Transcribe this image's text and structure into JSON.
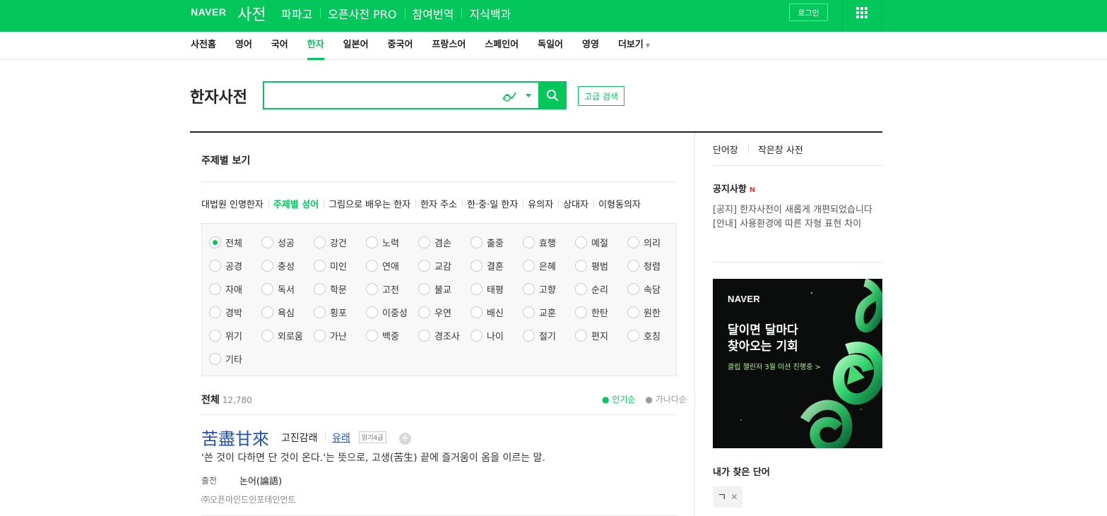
{
  "header": {
    "logo": "NAVER",
    "service": "사전",
    "nav": [
      "파파고",
      "오픈사전 PRO",
      "참여번역",
      "지식백과"
    ],
    "login_label": "로그인",
    "apps_icon": "apps-grid-icon"
  },
  "subnav": {
    "tabs": [
      "사전홈",
      "영어",
      "국어",
      "한자",
      "일본어",
      "중국어",
      "프랑스어",
      "스페인어",
      "독일어",
      "영영",
      "더보기"
    ],
    "active": "한자"
  },
  "search": {
    "title": "한자사전",
    "value": "",
    "advanced_label": "고급 검색"
  },
  "topic": {
    "title": "주제별 보기",
    "tabs": [
      "대법원 인명한자",
      "주제별 성어",
      "그림으로 배우는 한자",
      "한자 주소",
      "한·중·일 한자",
      "유의자",
      "상대자",
      "이형동의자"
    ],
    "active_tab": "주제별 성어",
    "options": [
      "전체",
      "성공",
      "강건",
      "노력",
      "겸손",
      "출중",
      "효행",
      "예절",
      "의리",
      "공경",
      "충성",
      "미인",
      "연애",
      "교감",
      "결혼",
      "은혜",
      "평범",
      "청렴",
      "자애",
      "독서",
      "학문",
      "고전",
      "불교",
      "태평",
      "고향",
      "순리",
      "속담",
      "경박",
      "욕심",
      "횡포",
      "이중성",
      "우연",
      "배신",
      "교훈",
      "한탄",
      "원한",
      "위기",
      "외로움",
      "가난",
      "백중",
      "경조사",
      "나이",
      "절기",
      "편지",
      "호칭",
      "기타"
    ],
    "selected": "전체"
  },
  "results": {
    "label": "전체",
    "count": "12,780",
    "sort_popular": "인기순",
    "sort_alpha": "가나다순",
    "entry": {
      "hanja": "苦盡甘來",
      "reading": "고진감래",
      "origin_label": "유래",
      "level": "읽기4급",
      "definition": "'쓴 것이 다하면 단 것이 온다.'는 뜻으로, 고생(苦生) 끝에 즐거움이 옴을 이르는 말.",
      "source_label": "출전",
      "source": "논어(論語)",
      "copyright": "㈜오픈마인드인포테인먼트"
    }
  },
  "sidebar": {
    "links": [
      "단어장",
      "작은창 사전"
    ],
    "notice_title": "공지사항",
    "notice_new": "N",
    "notices": [
      "[공지] 한자사전이 새롭게 개편되었습니다",
      "[안내] 사용환경에 따른 자형 표현 차이"
    ],
    "ad": {
      "logo": "NAVER",
      "headline_1": "달이면 달마다",
      "headline_2": "찾아오는 기회",
      "sub": "클립 챌린저 3월 미션 진행중 >"
    },
    "found_title": "내가 찾은 단어",
    "found_words": [
      "ㄱ"
    ]
  },
  "colors": {
    "brand": "#03c75a",
    "link": "#2350b7"
  }
}
